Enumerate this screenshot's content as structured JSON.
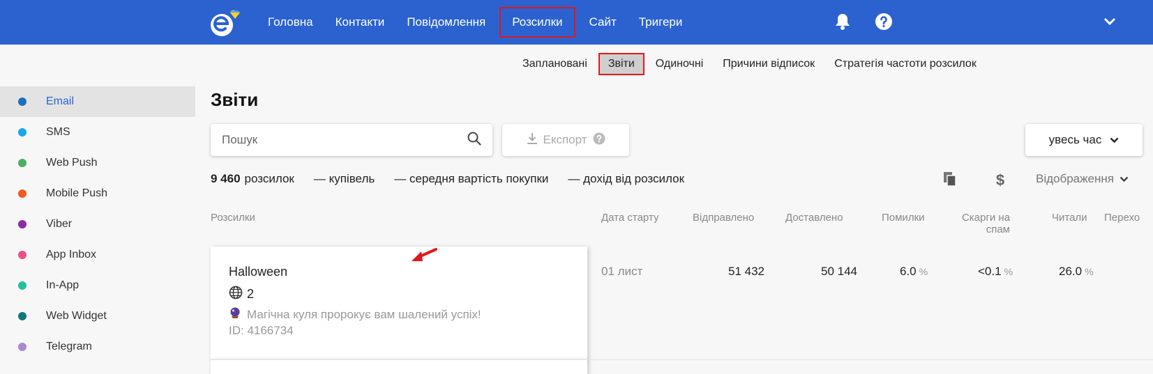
{
  "nav": {
    "items": [
      "Головна",
      "Контакти",
      "Повідомлення",
      "Розсилки",
      "Сайт",
      "Тригери"
    ],
    "active_index": 3
  },
  "subnav": {
    "items": [
      "Заплановані",
      "Звіти",
      "Одиночні",
      "Причини відписок",
      "Стратегія частоти розсилок"
    ],
    "active_index": 1
  },
  "sidebar": {
    "items": [
      {
        "label": "Email",
        "color": "#1f6fbf",
        "active": true
      },
      {
        "label": "SMS",
        "color": "#1aa7e8"
      },
      {
        "label": "Web Push",
        "color": "#4caf64"
      },
      {
        "label": "Mobile Push",
        "color": "#f05a1a"
      },
      {
        "label": "Viber",
        "color": "#8e2aa6"
      },
      {
        "label": "App Inbox",
        "color": "#ee4f8b"
      },
      {
        "label": "In-App",
        "color": "#22bfa0"
      },
      {
        "label": "Web Widget",
        "color": "#0e7a78"
      },
      {
        "label": "Telegram",
        "color": "#a98ad0"
      }
    ]
  },
  "page_title": "Звіти",
  "search": {
    "placeholder": "Пошук"
  },
  "export_label": "Експорт",
  "period_label": "увесь час",
  "stats": {
    "count": "9 460",
    "count_label": "розсилок",
    "purchases": "— купівель",
    "avg": "— середня вартість покупки",
    "revenue": "— дохід від розсилок"
  },
  "display_label": "Відображення",
  "table": {
    "headers": {
      "campaigns": "Розсилки",
      "start_date": "Дата старту",
      "sent": "Відправлено",
      "delivered": "Доставлено",
      "errors": "Помилки",
      "spam_line1": "Скарги на",
      "spam_line2": "спам",
      "read": "Читали",
      "clicks": "Перехо"
    },
    "row": {
      "title": "Halloween",
      "langs": "2",
      "subject": "Магічна куля пророкує вам шалений успіх!",
      "id": "ID: 4166734",
      "start_date": "01 лист",
      "sent": "51 432",
      "delivered": "50 144",
      "errors": "6.0",
      "spam": "<0.1",
      "read": "26.0",
      "pct": "%"
    }
  },
  "colors": {
    "brand": "#2b62d0",
    "highlight": "#e0181b"
  }
}
